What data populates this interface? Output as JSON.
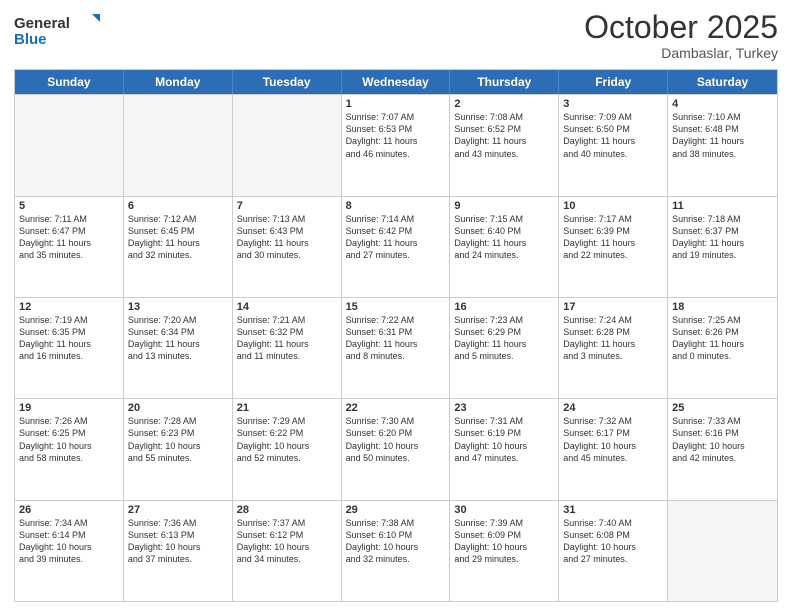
{
  "header": {
    "logo_general": "General",
    "logo_blue": "Blue",
    "month": "October 2025",
    "location": "Dambaslar, Turkey"
  },
  "days": [
    "Sunday",
    "Monday",
    "Tuesday",
    "Wednesday",
    "Thursday",
    "Friday",
    "Saturday"
  ],
  "weeks": [
    [
      {
        "day": "",
        "info": ""
      },
      {
        "day": "",
        "info": ""
      },
      {
        "day": "",
        "info": ""
      },
      {
        "day": "1",
        "info": "Sunrise: 7:07 AM\nSunset: 6:53 PM\nDaylight: 11 hours\nand 46 minutes."
      },
      {
        "day": "2",
        "info": "Sunrise: 7:08 AM\nSunset: 6:52 PM\nDaylight: 11 hours\nand 43 minutes."
      },
      {
        "day": "3",
        "info": "Sunrise: 7:09 AM\nSunset: 6:50 PM\nDaylight: 11 hours\nand 40 minutes."
      },
      {
        "day": "4",
        "info": "Sunrise: 7:10 AM\nSunset: 6:48 PM\nDaylight: 11 hours\nand 38 minutes."
      }
    ],
    [
      {
        "day": "5",
        "info": "Sunrise: 7:11 AM\nSunset: 6:47 PM\nDaylight: 11 hours\nand 35 minutes."
      },
      {
        "day": "6",
        "info": "Sunrise: 7:12 AM\nSunset: 6:45 PM\nDaylight: 11 hours\nand 32 minutes."
      },
      {
        "day": "7",
        "info": "Sunrise: 7:13 AM\nSunset: 6:43 PM\nDaylight: 11 hours\nand 30 minutes."
      },
      {
        "day": "8",
        "info": "Sunrise: 7:14 AM\nSunset: 6:42 PM\nDaylight: 11 hours\nand 27 minutes."
      },
      {
        "day": "9",
        "info": "Sunrise: 7:15 AM\nSunset: 6:40 PM\nDaylight: 11 hours\nand 24 minutes."
      },
      {
        "day": "10",
        "info": "Sunrise: 7:17 AM\nSunset: 6:39 PM\nDaylight: 11 hours\nand 22 minutes."
      },
      {
        "day": "11",
        "info": "Sunrise: 7:18 AM\nSunset: 6:37 PM\nDaylight: 11 hours\nand 19 minutes."
      }
    ],
    [
      {
        "day": "12",
        "info": "Sunrise: 7:19 AM\nSunset: 6:35 PM\nDaylight: 11 hours\nand 16 minutes."
      },
      {
        "day": "13",
        "info": "Sunrise: 7:20 AM\nSunset: 6:34 PM\nDaylight: 11 hours\nand 13 minutes."
      },
      {
        "day": "14",
        "info": "Sunrise: 7:21 AM\nSunset: 6:32 PM\nDaylight: 11 hours\nand 11 minutes."
      },
      {
        "day": "15",
        "info": "Sunrise: 7:22 AM\nSunset: 6:31 PM\nDaylight: 11 hours\nand 8 minutes."
      },
      {
        "day": "16",
        "info": "Sunrise: 7:23 AM\nSunset: 6:29 PM\nDaylight: 11 hours\nand 5 minutes."
      },
      {
        "day": "17",
        "info": "Sunrise: 7:24 AM\nSunset: 6:28 PM\nDaylight: 11 hours\nand 3 minutes."
      },
      {
        "day": "18",
        "info": "Sunrise: 7:25 AM\nSunset: 6:26 PM\nDaylight: 11 hours\nand 0 minutes."
      }
    ],
    [
      {
        "day": "19",
        "info": "Sunrise: 7:26 AM\nSunset: 6:25 PM\nDaylight: 10 hours\nand 58 minutes."
      },
      {
        "day": "20",
        "info": "Sunrise: 7:28 AM\nSunset: 6:23 PM\nDaylight: 10 hours\nand 55 minutes."
      },
      {
        "day": "21",
        "info": "Sunrise: 7:29 AM\nSunset: 6:22 PM\nDaylight: 10 hours\nand 52 minutes."
      },
      {
        "day": "22",
        "info": "Sunrise: 7:30 AM\nSunset: 6:20 PM\nDaylight: 10 hours\nand 50 minutes."
      },
      {
        "day": "23",
        "info": "Sunrise: 7:31 AM\nSunset: 6:19 PM\nDaylight: 10 hours\nand 47 minutes."
      },
      {
        "day": "24",
        "info": "Sunrise: 7:32 AM\nSunset: 6:17 PM\nDaylight: 10 hours\nand 45 minutes."
      },
      {
        "day": "25",
        "info": "Sunrise: 7:33 AM\nSunset: 6:16 PM\nDaylight: 10 hours\nand 42 minutes."
      }
    ],
    [
      {
        "day": "26",
        "info": "Sunrise: 7:34 AM\nSunset: 6:14 PM\nDaylight: 10 hours\nand 39 minutes."
      },
      {
        "day": "27",
        "info": "Sunrise: 7:36 AM\nSunset: 6:13 PM\nDaylight: 10 hours\nand 37 minutes."
      },
      {
        "day": "28",
        "info": "Sunrise: 7:37 AM\nSunset: 6:12 PM\nDaylight: 10 hours\nand 34 minutes."
      },
      {
        "day": "29",
        "info": "Sunrise: 7:38 AM\nSunset: 6:10 PM\nDaylight: 10 hours\nand 32 minutes."
      },
      {
        "day": "30",
        "info": "Sunrise: 7:39 AM\nSunset: 6:09 PM\nDaylight: 10 hours\nand 29 minutes."
      },
      {
        "day": "31",
        "info": "Sunrise: 7:40 AM\nSunset: 6:08 PM\nDaylight: 10 hours\nand 27 minutes."
      },
      {
        "day": "",
        "info": ""
      }
    ]
  ]
}
